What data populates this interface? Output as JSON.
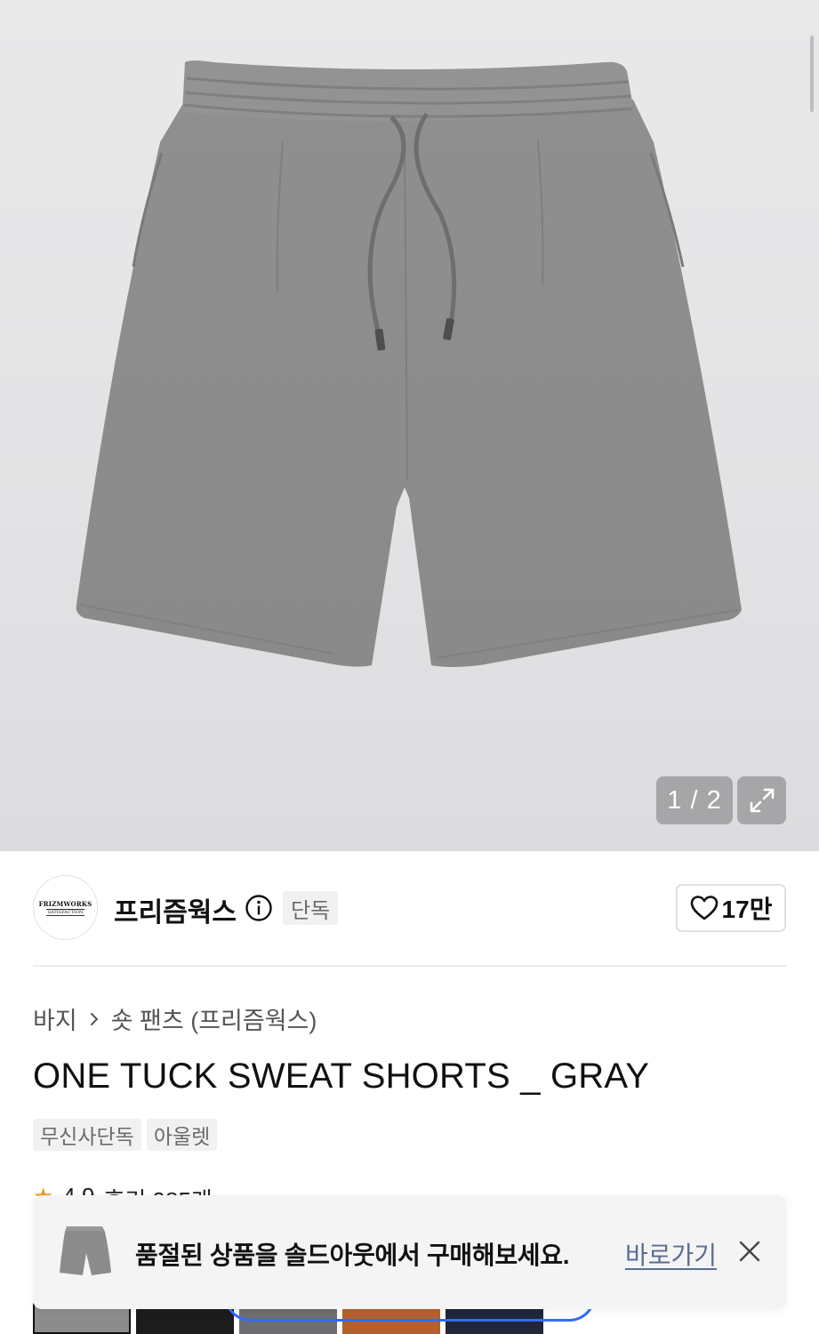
{
  "gallery": {
    "counter": "1 / 2"
  },
  "brand": {
    "name": "프리즘웍스",
    "logo_line1": "FRIZMWORKS",
    "logo_line2": "SATISFACTION",
    "exclusive_tag": "단독",
    "like_count": "17만"
  },
  "breadcrumb": {
    "category": "바지",
    "subcategory": "숏 팬츠 (프리즘웍스)"
  },
  "product": {
    "title": "ONE TUCK SWEAT SHORTS _ GRAY",
    "tags": [
      "무신사단독",
      "아울렛"
    ],
    "rating_star": "★",
    "rating_peek": "4.9",
    "review_peek": "후기 985개"
  },
  "toast": {
    "message": "품절된 상품을 솔드아웃에서 구매해보세요.",
    "link_label": "바로가기"
  },
  "colors": {
    "accent_blue": "#2f6bff",
    "link": "#5a6e8f",
    "star": "#f39a1c"
  }
}
